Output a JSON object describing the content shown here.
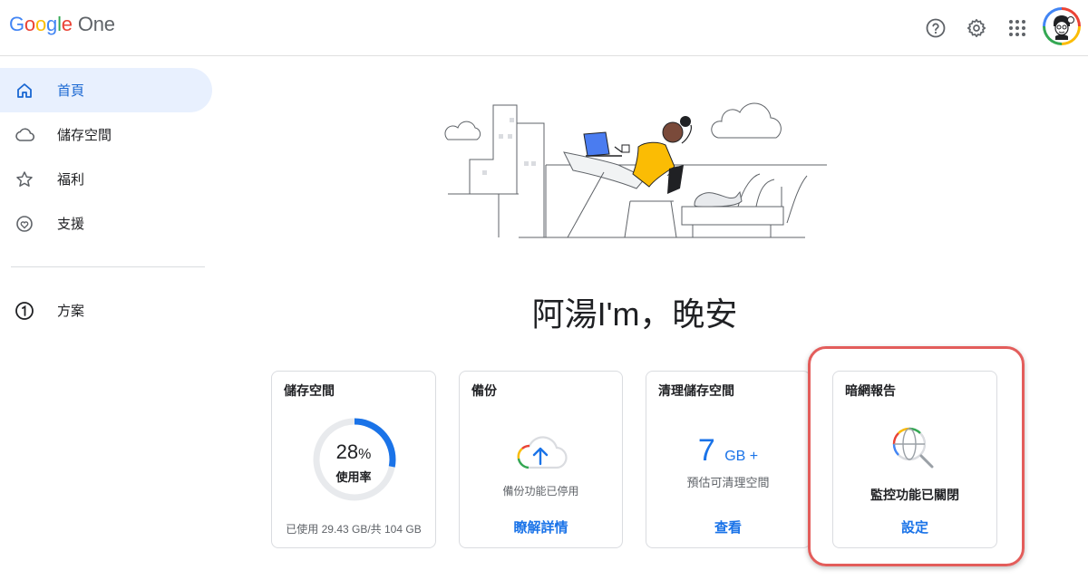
{
  "app": {
    "logo_text": "Google",
    "product_text": "One"
  },
  "header": {
    "icons": [
      "help-icon",
      "settings-icon",
      "apps-grid-icon"
    ],
    "avatar": "user-avatar"
  },
  "sidebar": {
    "items": [
      {
        "label": "首頁",
        "icon": "home-icon",
        "active": true
      },
      {
        "label": "儲存空間",
        "icon": "cloud-icon",
        "active": false
      },
      {
        "label": "福利",
        "icon": "star-icon",
        "active": false
      },
      {
        "label": "支援",
        "icon": "heart-support-icon",
        "active": false
      }
    ],
    "plan_item": {
      "label": "方案",
      "icon": "plan-one-icon"
    }
  },
  "main": {
    "greeting": "阿湯I'm，晚安",
    "cards": [
      {
        "title": "儲存空間",
        "percent_value": "28",
        "percent_sign": "%",
        "usage_label": "使用率",
        "usage_fraction": 0.28,
        "caption": "已使用 29.43 GB/共 104 GB"
      },
      {
        "title": "備份",
        "caption": "備份功能已停用",
        "link": "瞭解詳情"
      },
      {
        "title": "清理儲存空間",
        "amount": "7",
        "unit": "GB +",
        "caption": "預估可清理空間",
        "link": "查看"
      },
      {
        "title": "暗網報告",
        "status": "監控功能已關閉",
        "link": "設定"
      }
    ]
  },
  "colors": {
    "accent": "#1a73e8",
    "active_nav_bg": "#e8f0fe",
    "highlight": "#e35d5b"
  }
}
